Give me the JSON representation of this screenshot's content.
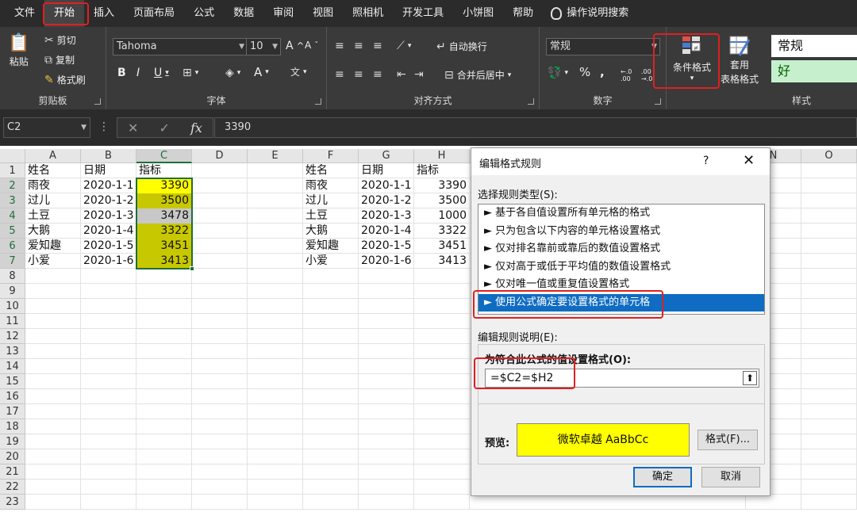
{
  "ribbon_tabs": [
    "文件",
    "开始",
    "插入",
    "页面布局",
    "公式",
    "数据",
    "审阅",
    "视图",
    "照相机",
    "开发工具",
    "小饼图",
    "帮助"
  ],
  "tell_me": "操作说明搜索",
  "clipboard": {
    "paste": "粘贴",
    "cut": "剪切",
    "copy": "复制",
    "format_painter": "格式刷",
    "label": "剪贴板"
  },
  "font": {
    "name": "Tahoma",
    "size": "10",
    "grow": "A",
    "shrink": "A",
    "bold": "B",
    "italic": "I",
    "underline": "U",
    "color_a": "A",
    "label": "字体"
  },
  "alignment": {
    "wrap": "自动换行",
    "merge": "合并后居中",
    "label": "对齐方式"
  },
  "number": {
    "format": "常规",
    "percent": "%",
    "comma": ",",
    "inc_dec": "←.0 .00",
    "dec_dec": ".00 →.0",
    "label": "数字"
  },
  "styles": {
    "conditional": "条件格式",
    "table_line1": "套用",
    "table_line2": "表格格式",
    "style_normal": "常规",
    "style_good": "好",
    "label": "样式"
  },
  "formula_bar": {
    "name_box": "C2",
    "fx": "fx",
    "value": "3390"
  },
  "columns": [
    "A",
    "B",
    "C",
    "D",
    "E",
    "F",
    "G",
    "H",
    "N",
    "O"
  ],
  "rows": [
    "1",
    "2",
    "3",
    "4",
    "5",
    "6",
    "7",
    "8",
    "9",
    "10",
    "11",
    "12",
    "13",
    "14",
    "15",
    "16",
    "17",
    "18",
    "19",
    "20",
    "21",
    "22",
    "23"
  ],
  "table_left": {
    "headers": [
      "姓名",
      "日期",
      "指标"
    ],
    "data": [
      [
        "雨夜",
        "2020-1-1",
        "3390"
      ],
      [
        "过儿",
        "2020-1-2",
        "3500"
      ],
      [
        "土豆",
        "2020-1-3",
        "3478"
      ],
      [
        "大鹅",
        "2020-1-4",
        "3322"
      ],
      [
        "爱知趣",
        "2020-1-5",
        "3451"
      ],
      [
        "小爱",
        "2020-1-6",
        "3413"
      ]
    ],
    "fill_colors": [
      "#ffff00",
      "#c8c800",
      "#c8c8c8",
      "#c8c800",
      "#c8c800",
      "#c8c800"
    ]
  },
  "table_right": {
    "headers": [
      "姓名",
      "日期",
      "指标"
    ],
    "data": [
      [
        "雨夜",
        "2020-1-1",
        "3390"
      ],
      [
        "过儿",
        "2020-1-2",
        "3500"
      ],
      [
        "土豆",
        "2020-1-3",
        "1000"
      ],
      [
        "大鹅",
        "2020-1-4",
        "3322"
      ],
      [
        "爱知趣",
        "2020-1-5",
        "3451"
      ],
      [
        "小爱",
        "2020-1-6",
        "3413"
      ]
    ]
  },
  "dialog": {
    "title": "编辑格式规则",
    "help": "?",
    "close": "✕",
    "select_type_label": "选择规则类型(S):",
    "rules": [
      "► 基于各自值设置所有单元格的格式",
      "► 只为包含以下内容的单元格设置格式",
      "► 仅对排名靠前或靠后的数值设置格式",
      "► 仅对高于或低于平均值的数值设置格式",
      "► 仅对唯一值或重复值设置格式",
      "► 使用公式确定要设置格式的单元格"
    ],
    "edit_desc_label": "编辑规则说明(E):",
    "formula_label": "为符合此公式的值设置格式(O):",
    "formula_value": "=$C2=$H2",
    "preview_label": "预览:",
    "preview_text": "微软卓越  AaBbCc",
    "format_button": "格式(F)...",
    "ok": "确定",
    "cancel": "取消"
  }
}
